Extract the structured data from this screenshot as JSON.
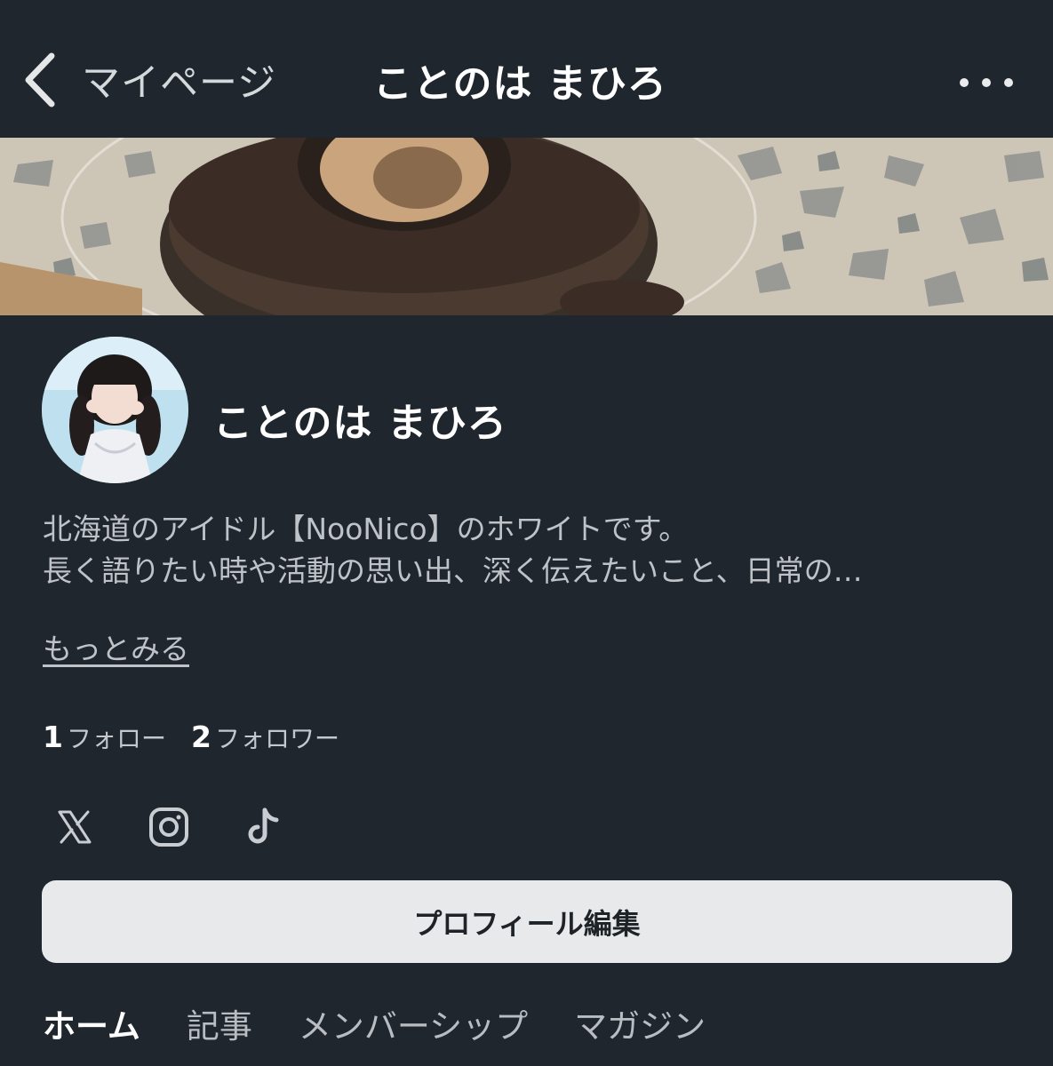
{
  "nav": {
    "back_label": "マイページ",
    "title": "ことのは まひろ"
  },
  "profile": {
    "name": "ことのは まひろ",
    "bio_lines": [
      "北海道のアイドル【NooNico】のホワイトです。",
      "長く語りたい時や活動の思い出、深く伝えたいこと、日常の…"
    ],
    "more_label": "もっとみる",
    "follow_count": "1",
    "follow_label": "フォロー",
    "follower_count": "2",
    "follower_label": "フォロワー",
    "socials": [
      "x-icon",
      "instagram-icon",
      "tiktok-icon"
    ],
    "edit_label": "プロフィール編集"
  },
  "tabs": [
    {
      "label": "ホーム",
      "active": true
    },
    {
      "label": "記事",
      "active": false
    },
    {
      "label": "メンバーシップ",
      "active": false
    },
    {
      "label": "マガジン",
      "active": false
    }
  ],
  "colors": {
    "background": "#1f262e",
    "button_bg": "#e8e9eb"
  }
}
